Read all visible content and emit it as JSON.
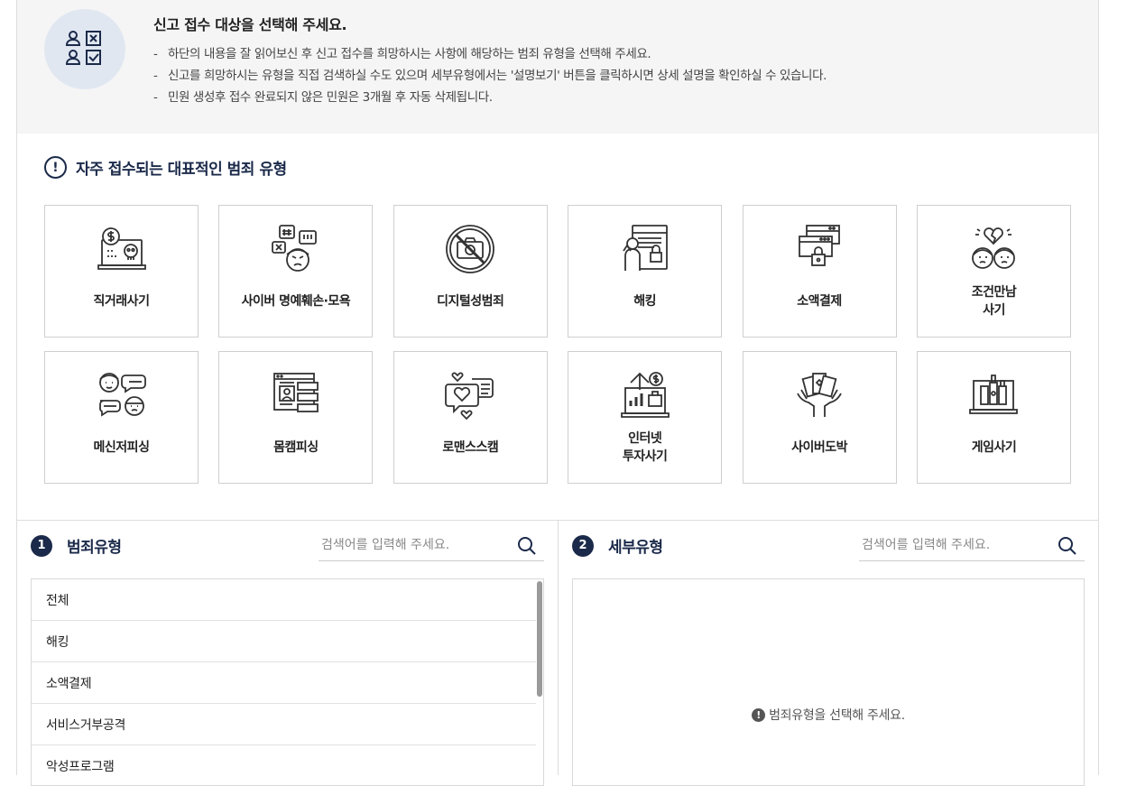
{
  "guide": {
    "title": "신고 접수 대상을 선택해 주세요.",
    "lines": [
      "하단의 내용을 잘 읽어보신 후 신고 접수를 희망하시는 사항에 해당하는 범죄 유형을 선택해 주세요.",
      "신고를 희망하시는 유형을 직접 검색하실 수도 있으며 세부유형에서는 '설명보기' 버튼을 클릭하시면 상세 설명을 확인하실 수 있습니다.",
      "민원 생성후 접수 완료되지 않은 민원은 3개월 후 자동 삭제됩니다."
    ]
  },
  "frequent": {
    "title": "자주 접수되는 대표적인 범죄 유형",
    "alert_glyph": "!",
    "items": [
      {
        "label": "직거래사기",
        "icon": "laptop-dollar-skull-icon"
      },
      {
        "label": "사이버 명예훼손·모욕",
        "icon": "speech-bubbles-angry-face-icon"
      },
      {
        "label": "디지털성범죄",
        "icon": "no-camera-icon"
      },
      {
        "label": "해킹",
        "icon": "hacker-lock-icon"
      },
      {
        "label": "소액결제",
        "icon": "browser-lock-icon"
      },
      {
        "label": "조건만남\n사기",
        "icon": "broken-heart-couple-icon"
      },
      {
        "label": "메신저피싱",
        "icon": "messenger-people-icon"
      },
      {
        "label": "몸캠피싱",
        "icon": "video-chat-id-icon"
      },
      {
        "label": "로맨스스캠",
        "icon": "heart-chat-icon"
      },
      {
        "label": "인터넷\n투자사기",
        "icon": "investment-chart-icon"
      },
      {
        "label": "사이버도박",
        "icon": "cards-hands-icon"
      },
      {
        "label": "게임사기",
        "icon": "laptop-game-icon"
      }
    ]
  },
  "crime_type": {
    "step": "1",
    "title": "범죄유형",
    "search_placeholder": "검색어를 입력해 주세요.",
    "items": [
      "전체",
      "해킹",
      "소액결제",
      "서비스거부공격",
      "악성프로그램"
    ]
  },
  "sub_type": {
    "step": "2",
    "title": "세부유형",
    "search_placeholder": "검색어를 입력해 주세요.",
    "empty_glyph": "!",
    "empty_message": "범죄유형을 선택해 주세요."
  },
  "colors": {
    "navy": "#1b2a4a",
    "guide_bg": "#f5f5f5",
    "icon_circle": "#e1e7f1"
  }
}
